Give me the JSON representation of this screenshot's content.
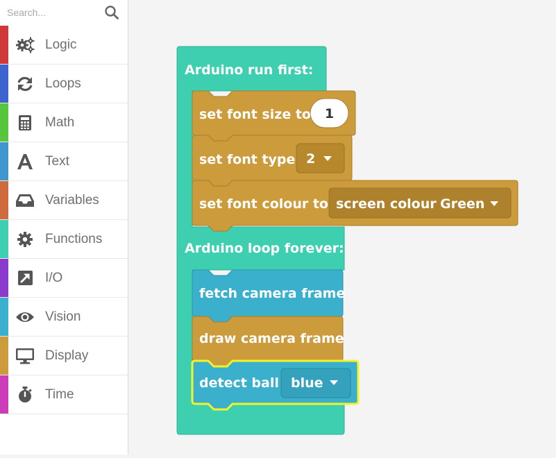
{
  "search": {
    "placeholder": "Search..."
  },
  "categories": [
    {
      "label": "Logic",
      "icon": "gears-icon",
      "color": "#d0393a"
    },
    {
      "label": "Loops",
      "icon": "refresh-icon",
      "color": "#3d64cc"
    },
    {
      "label": "Math",
      "icon": "calculator-icon",
      "color": "#55c63e"
    },
    {
      "label": "Text",
      "icon": "letter-a-icon",
      "color": "#3f97cd"
    },
    {
      "label": "Variables",
      "icon": "inbox-tray-icon",
      "color": "#cf6a3c"
    },
    {
      "label": "Functions",
      "icon": "gear-icon",
      "color": "#3ecfb0"
    },
    {
      "label": "I/O",
      "icon": "external-link-icon",
      "color": "#8a3bcb"
    },
    {
      "label": "Vision",
      "icon": "eye-icon",
      "color": "#3ab0cc"
    },
    {
      "label": "Display",
      "icon": "monitor-icon",
      "color": "#cc9b3b"
    },
    {
      "label": "Time",
      "icon": "stopwatch-icon",
      "color": "#cc3bb8"
    }
  ],
  "blocks": {
    "setup_label": "Arduino run first:",
    "set_font_size_label": "set font size to",
    "set_font_size_value": "1",
    "set_font_type_label": "set font type",
    "set_font_type_value": "2",
    "set_font_colour_label": "set font colour to",
    "screen_colour_label": "screen colour",
    "screen_colour_value": "Green",
    "loop_label": "Arduino loop forever:",
    "fetch_label": "fetch camera frame",
    "draw_label": "draw camera frame",
    "detect_label": "detect ball",
    "detect_value": "blue"
  },
  "colors": {
    "event_block": "#3ecfb0",
    "display_block": "#cc9b3b",
    "vision_block": "#3ab0cc",
    "selection_outline": "#f3f32a"
  }
}
